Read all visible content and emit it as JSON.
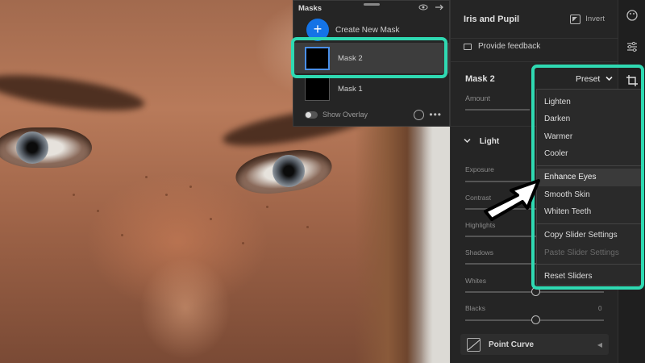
{
  "masks_panel": {
    "title": "Masks",
    "create_label": "Create New Mask",
    "items": [
      {
        "name": "Mask 2",
        "selected": true
      },
      {
        "name": "Mask 1",
        "selected": false
      }
    ],
    "show_overlay_label": "Show Overlay"
  },
  "right_panel": {
    "section_title": "Iris and Pupil",
    "invert_label": "Invert",
    "feedback_label": "Provide feedback",
    "mask_name": "Mask 2",
    "preset_label": "Preset",
    "amount_label": "Amount",
    "light_label": "Light",
    "sliders": [
      {
        "label": "Exposure",
        "value": ""
      },
      {
        "label": "Contrast",
        "value": ""
      },
      {
        "label": "Highlights",
        "value": ""
      },
      {
        "label": "Shadows",
        "value": ""
      },
      {
        "label": "Whites",
        "value": ""
      },
      {
        "label": "Blacks",
        "value": "0"
      }
    ],
    "point_curve_label": "Point Curve"
  },
  "preset_menu": {
    "group1": [
      "Lighten",
      "Darken",
      "Warmer",
      "Cooler"
    ],
    "group2": [
      "Enhance Eyes",
      "Smooth Skin",
      "Whiten Teeth"
    ],
    "group3": [
      "Copy Slider Settings",
      "Paste Slider Settings"
    ],
    "group4": [
      "Reset Sliders"
    ],
    "highlighted": "Enhance Eyes",
    "disabled": [
      "Paste Slider Settings"
    ]
  },
  "colors": {
    "highlight": "#2fd9b2",
    "accent": "#1473e6"
  }
}
